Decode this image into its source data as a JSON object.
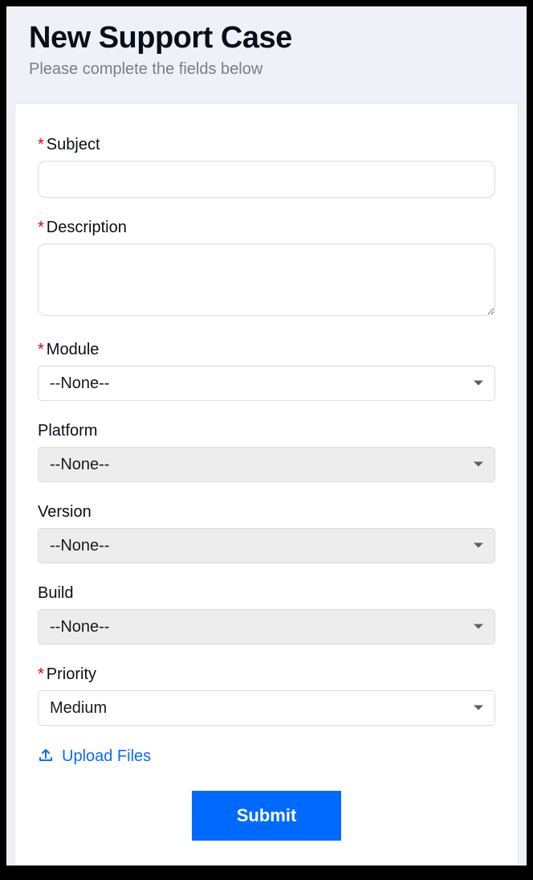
{
  "header": {
    "title": "New Support Case",
    "subtitle": "Please complete the fields below"
  },
  "form": {
    "subject": {
      "label": "Subject",
      "value": ""
    },
    "description": {
      "label": "Description",
      "value": ""
    },
    "module": {
      "label": "Module",
      "selected": "--None--"
    },
    "platform": {
      "label": "Platform",
      "selected": "--None--"
    },
    "version": {
      "label": "Version",
      "selected": "--None--"
    },
    "build": {
      "label": "Build",
      "selected": "--None--"
    },
    "priority": {
      "label": "Priority",
      "selected": "Medium"
    }
  },
  "upload": {
    "label": "Upload Files"
  },
  "actions": {
    "submit": "Submit"
  }
}
